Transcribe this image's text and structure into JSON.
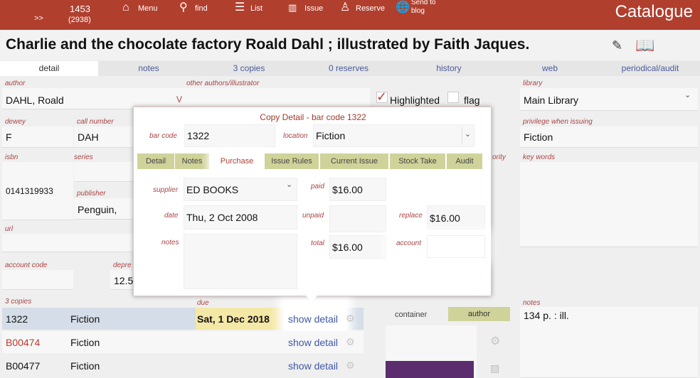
{
  "topbar": {
    "nav_arrows": ">>",
    "count_current": "1453",
    "count_total": "(2938)",
    "menu": "Menu",
    "find": "find",
    "list": "List",
    "issue": "Issue",
    "reserve": "Reserve",
    "send_to_blog": "Send to blog",
    "catalogue": "Catalogue",
    "color": "#b13f2e"
  },
  "record": {
    "title": "Charlie and the chocolate factory Roald Dahl ; illustrated by Faith Jaques."
  },
  "tabs": [
    "detail",
    "notes",
    "3 copies",
    "0 reserves",
    "history",
    "web",
    "periodical/audit"
  ],
  "fields": {
    "author_label": "author",
    "author": "DAHL, Roald",
    "author_v": "V",
    "other_authors_label": "other authors/illustrator",
    "highlighted": "Highlighted",
    "flag": "flag",
    "library_label": "library",
    "library": "Main Library",
    "dewey_label": "dewey",
    "dewey": "F",
    "call_number_label": "call number",
    "call_number": "DAH",
    "privilege_label": "privilege when issuing",
    "privilege": "Fiction",
    "isbn_label": "isbn",
    "isbn": "0141319933",
    "series_label": "series",
    "publisher_label": "publisher",
    "publisher": "Penguin,",
    "key_words_label": "key words",
    "url_label": "url",
    "account_code_label": "account code",
    "depreciation_label": "depre",
    "depreciation": "12.5",
    "priority_fragment": "ority"
  },
  "copies": {
    "label": "3 copies",
    "due_label": "due",
    "copies_fragment": "copies",
    "rows": [
      {
        "barcode": "1322",
        "type": "Fiction",
        "due": "Sat, 1 Dec 2018",
        "action": "show detail"
      },
      {
        "barcode": "B00474",
        "type": "Fiction",
        "due": "",
        "action": "show detail"
      },
      {
        "barcode": "B00477",
        "type": "Fiction",
        "due": "",
        "action": "show detail"
      }
    ]
  },
  "side": {
    "container": "container",
    "author_btn": "author",
    "notes_label": "notes",
    "notes": "134 p. : ill."
  },
  "modal": {
    "title": "Copy Detail - bar code 1322",
    "bar_code_label": "bar code",
    "bar_code": "1322",
    "location_label": "location",
    "location": "Fiction",
    "tabs": [
      "Detail",
      "Notes",
      "Purchase",
      "Issue Rules",
      "Current Issue",
      "Stock Take",
      "Audit"
    ],
    "active_tab": "Purchase",
    "supplier_label": "supplier",
    "supplier": "ED BOOKS",
    "paid_label": "paid",
    "paid": "$16.00",
    "date_label": "date",
    "date": "Thu, 2 Oct 2008",
    "unpaid_label": "unpaid",
    "unpaid": "",
    "replace_label": "replace",
    "replace": "$16.00",
    "notes_label": "notes",
    "total_label": "total",
    "total": "$16.00",
    "account_label": "account",
    "account": ""
  }
}
